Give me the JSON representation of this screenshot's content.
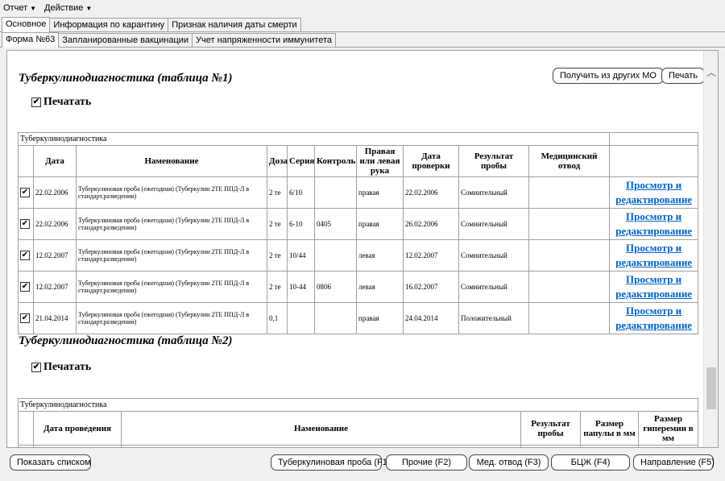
{
  "menu": [
    {
      "label": "Отчет"
    },
    {
      "label": "Действие"
    }
  ],
  "tabs_top": [
    "Основное",
    "Информация по карантину",
    "Признак наличия даты смерти"
  ],
  "tabs_second": [
    "Форма №63",
    "Запланированные вакцинации",
    "Учет напряженности иммунитета"
  ],
  "table1": {
    "section_title": "Туберкулинодиагностика (таблица №1)",
    "print_label": "Печатать",
    "caption": "Туберкулинодиагностика",
    "get_from_mo_label": "Получить из других МО",
    "print_button_label": "Печать",
    "headers": [
      "Дата",
      "Наменование",
      "Доза",
      "Серия",
      "Контроль",
      "Правая или левая рука",
      "Дата проверки",
      "Результат пробы",
      "Медицинский отвод"
    ],
    "rows": [
      {
        "date": "22.02.2006",
        "name": "Туберкулиновая проба (ежегодная) (Туберкулин 2ТЕ ППД-Л в стандарт.разведении)",
        "dose": "2 те",
        "series": "6/10",
        "control": "",
        "hand": "правая",
        "check_date": "22.02.2006",
        "result": "Сомнительный",
        "medical": "",
        "link": "Просмотр и редактирование"
      },
      {
        "date": "22.02.2006",
        "name": "Туберкулиновая проба (ежегодная) (Туберкулин 2ТЕ ППД-Л в стандарт.разведении)",
        "dose": "2 те",
        "series": "6-10",
        "control": "0405",
        "hand": "правая",
        "check_date": "26.02.2006",
        "result": "Сомнительный",
        "medical": "",
        "link": "Просмотр и редактирование"
      },
      {
        "date": "12.02.2007",
        "name": "Туберкулиновая проба (ежегодная) (Туберкулин 2ТЕ ППД-Л в стандарт.разведении)",
        "dose": "2 те",
        "series": "10/44",
        "control": "",
        "hand": "левая",
        "check_date": "12.02.2007",
        "result": "Сомнительный",
        "medical": "",
        "link": "Просмотр и редактирование"
      },
      {
        "date": "12.02.2007",
        "name": "Туберкулиновая проба (ежегодная) (Туберкулин 2ТЕ ППД-Л в стандарт.разведении)",
        "dose": "2 те",
        "series": "10-44",
        "control": "0806",
        "hand": "левая",
        "check_date": "16.02.2007",
        "result": "Сомнительный",
        "medical": "",
        "link": "Просмотр и редактирование"
      },
      {
        "date": "21.04.2014",
        "name": "Туберкулиновая проба (ежегодная) (Туберкулин 2ТЕ ППД-Л в стандарт.разведении)",
        "dose": "0,1",
        "series": "",
        "control": "",
        "hand": "правая",
        "check_date": "24.04.2014",
        "result": "Положительный",
        "medical": "",
        "link": "Просмотр и редактирование"
      }
    ]
  },
  "table2": {
    "section_title": "Туберкулинодиагностика (таблица №2)",
    "print_label": "Печатать",
    "caption": "Туберкулинодиагностика",
    "headers": [
      "Дата проведения",
      "Наменование",
      "Результат пробы",
      "Размер папулы в мм",
      "Размер гиперемии в мм"
    ]
  },
  "bottom_buttons": {
    "show_list": "Показать списком",
    "tb_test": "Туберкулиновая проба (F1)",
    "other": "Прочие (F2)",
    "med_exempt": "Мед. отвод (F3)",
    "bcg": "БЦЖ (F4)",
    "referral": "Направление (F5)"
  },
  "colors": {
    "link": "#0063c9"
  }
}
